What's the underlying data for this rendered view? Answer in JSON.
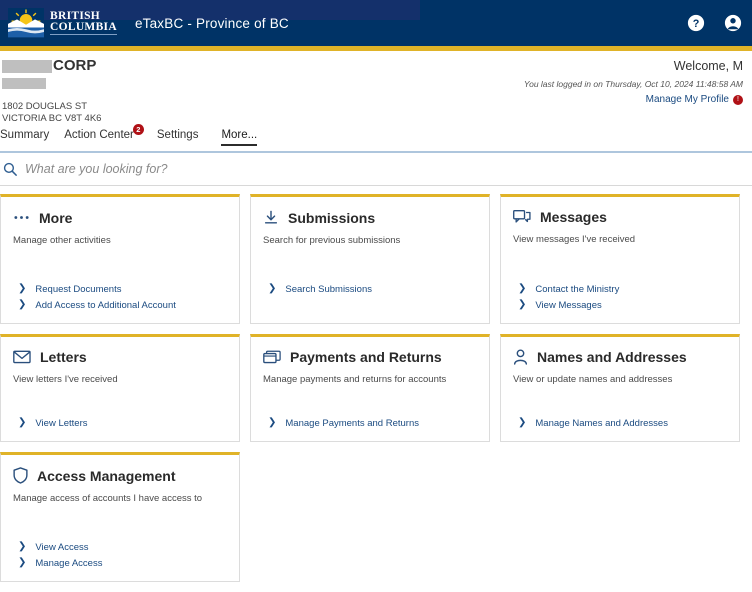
{
  "header": {
    "app_title": "eTaxBC - Province of BC",
    "logo_line1": "BRITISH",
    "logo_line2": "COLUMBIA",
    "help_icon": "help-circle-icon",
    "account_icon": "user-circle-icon",
    "bg_color": "#003366",
    "accent_color": "#e0b328"
  },
  "account": {
    "corp_suffix": "CORP",
    "address_line1": "1802 DOUGLAS ST",
    "address_line2": "VICTORIA BC V8T 4K6",
    "welcome": "Welcome, M",
    "last_login": "You last logged in on Thursday, Oct 10, 2024 11:48:58 AM",
    "manage_profile": "Manage My Profile",
    "profile_badge": "!"
  },
  "tabs": [
    {
      "label": "Summary",
      "active": false,
      "badge": null
    },
    {
      "label": "Action Center",
      "active": false,
      "badge": "2"
    },
    {
      "label": "Settings",
      "active": false,
      "badge": null
    },
    {
      "label": "More...",
      "active": true,
      "badge": null
    }
  ],
  "search": {
    "placeholder": "What are you looking for?",
    "value": "",
    "icon": "search-icon"
  },
  "cards": [
    {
      "title": "More",
      "icon": "ellipsis-icon",
      "subtitle": "Manage other activities",
      "links": [
        "Request Documents",
        "Add Access to Additional Account"
      ]
    },
    {
      "title": "Submissions",
      "icon": "download-arrow-icon",
      "subtitle": "Search for previous submissions",
      "links": [
        "Search Submissions"
      ]
    },
    {
      "title": "Messages",
      "icon": "chat-bubbles-icon",
      "subtitle": "View messages I've received",
      "links": [
        "Contact the Ministry",
        "View Messages"
      ]
    },
    {
      "title": "Letters",
      "icon": "envelope-icon",
      "subtitle": "View letters I've received",
      "links": [
        "View Letters"
      ]
    },
    {
      "title": "Payments and Returns",
      "icon": "card-stack-icon",
      "subtitle": "Manage payments and returns for accounts",
      "links": [
        "Manage Payments and Returns"
      ]
    },
    {
      "title": "Names and Addresses",
      "icon": "person-icon",
      "subtitle": "View or update names and addresses",
      "links": [
        "Manage Names and Addresses"
      ]
    },
    {
      "title": "Access Management",
      "icon": "shield-icon",
      "subtitle": "Manage access of accounts I have access to",
      "links": [
        "View Access",
        "Manage Access"
      ]
    }
  ]
}
